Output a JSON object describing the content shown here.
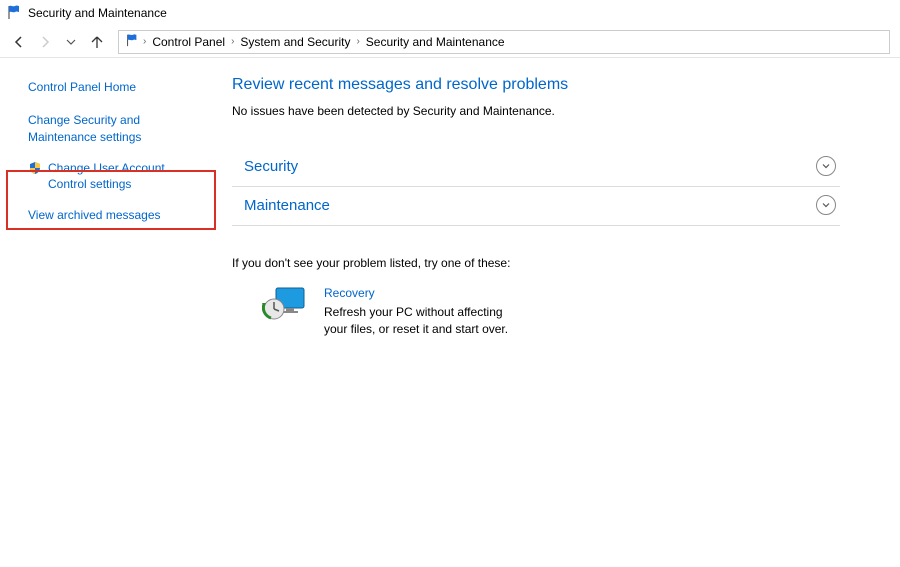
{
  "window": {
    "title": "Security and Maintenance"
  },
  "breadcrumb": {
    "items": [
      "Control Panel",
      "System and Security",
      "Security and Maintenance"
    ]
  },
  "sidebar": {
    "home": "Control Panel Home",
    "links": [
      {
        "label": "Change Security and Maintenance settings",
        "shield": false
      },
      {
        "label": "Change User Account Control settings",
        "shield": true
      },
      {
        "label": "View archived messages",
        "shield": false
      }
    ]
  },
  "main": {
    "heading": "Review recent messages and resolve problems",
    "status": "No issues have been detected by Security and Maintenance.",
    "sections": [
      {
        "title": "Security"
      },
      {
        "title": "Maintenance"
      }
    ],
    "footer": "If you don't see your problem listed, try one of these:",
    "recovery": {
      "title": "Recovery",
      "desc": "Refresh your PC without affecting your files, or reset it and start over."
    }
  }
}
